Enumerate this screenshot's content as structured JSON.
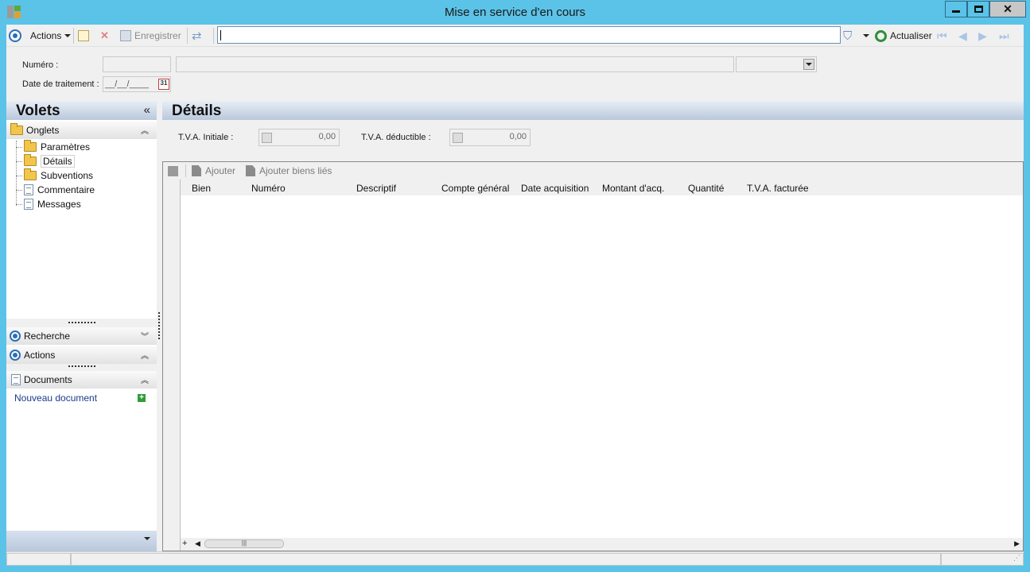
{
  "window": {
    "title": "Mise en service d'en cours"
  },
  "toolbar": {
    "actions_label": "Actions",
    "save_label": "Enregistrer",
    "search_value": "",
    "refresh_label": "Actualiser"
  },
  "header": {
    "numero_label": "Numéro :",
    "numero_value": "",
    "description_value": "",
    "combo_value": "",
    "date_label": "Date de traitement :",
    "date_value": "__/__/____",
    "calendar_day": "31"
  },
  "left_pane": {
    "title": "Volets",
    "onglets_label": "Onglets",
    "items": [
      {
        "label": "Paramètres",
        "icon": "folder-icon"
      },
      {
        "label": "Détails",
        "icon": "folder-open-icon"
      },
      {
        "label": "Subventions",
        "icon": "folder-icon"
      },
      {
        "label": "Commentaire",
        "icon": "document-icon"
      },
      {
        "label": "Messages",
        "icon": "document-icon"
      }
    ],
    "recherche_label": "Recherche",
    "actions_label": "Actions",
    "documents_label": "Documents",
    "new_document_label": "Nouveau document"
  },
  "details": {
    "title": "Détails",
    "tva_initiale_label": "T.V.A. Initiale :",
    "tva_initiale_value": "0,00",
    "tva_deductible_label": "T.V.A. déductible :",
    "tva_deductible_value": "0,00"
  },
  "grid": {
    "add_label": "Ajouter",
    "add_linked_label": "Ajouter biens liés",
    "columns": [
      "Bien",
      "Numéro",
      "Descriptif",
      "Compte général",
      "Date acquisition",
      "Montant d'acq.",
      "Quantité",
      "T.V.A. facturée"
    ],
    "rows": []
  },
  "colors": {
    "titlebar": "#5bc3e8",
    "pane_header": "#b9c8dc",
    "accent_blue": "#2a6fb5"
  }
}
